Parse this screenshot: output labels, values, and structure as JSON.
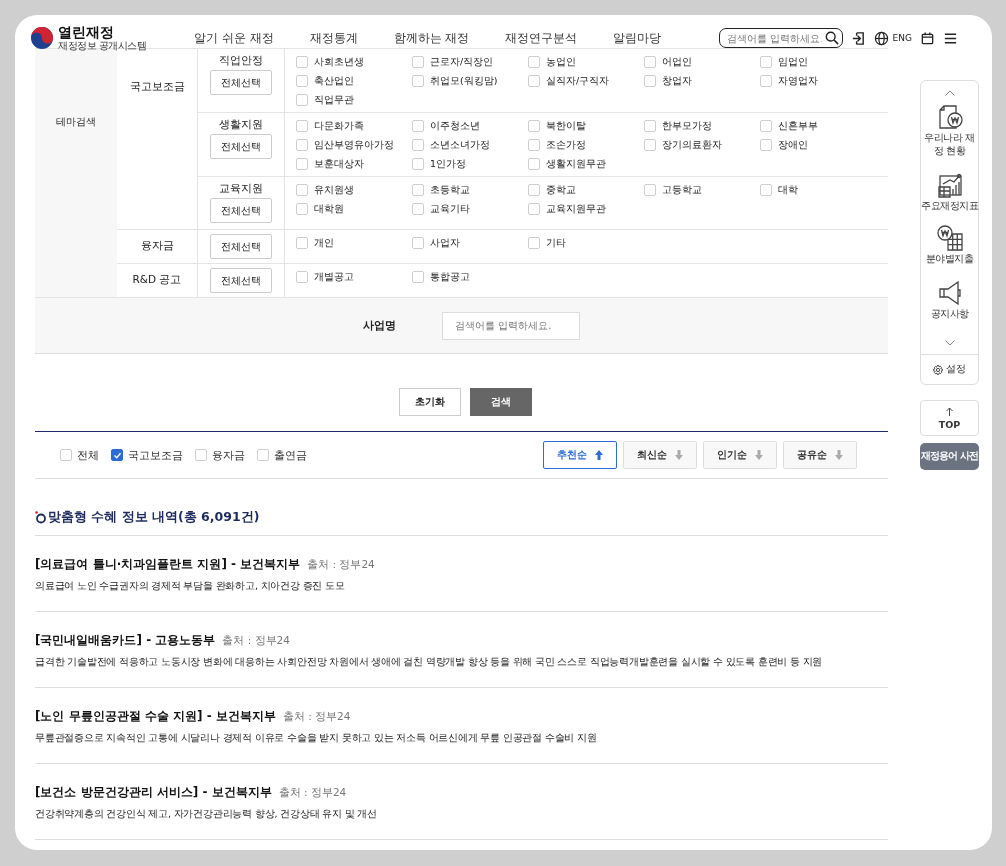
{
  "header": {
    "logo_title": "열린재정",
    "logo_subtitle": "재정정보 공개시스템",
    "nav": [
      "알기 쉬운 재정",
      "재정통계",
      "함께하는 재정",
      "재정연구분석",
      "알림마당"
    ],
    "search": {
      "placeholder": "검색어를 입력하세요."
    },
    "language": "ENG"
  },
  "filter_table": {
    "section": "테마검색",
    "groups": [
      {
        "label": "국고보조금",
        "subgroups": [
          {
            "label": "직업안정",
            "button": "전체선택",
            "options": [
              {
                "label": "사회초년생",
                "checked": false
              },
              {
                "label": "근로자/직장인",
                "checked": false
              },
              {
                "label": "농업인",
                "checked": false
              },
              {
                "label": "어업인",
                "checked": false
              },
              {
                "label": "임업인",
                "checked": false
              },
              {
                "label": "축산업인",
                "checked": false
              },
              {
                "label": "취업모(워킹맘)",
                "checked": false
              },
              {
                "label": "실직자/구직자",
                "checked": false
              },
              {
                "label": "창업자",
                "checked": false
              },
              {
                "label": "자영업자",
                "checked": false
              },
              {
                "label": "직업무관",
                "checked": false
              }
            ]
          },
          {
            "label": "생활지원",
            "button": "전체선택",
            "options": [
              {
                "label": "다문화가족",
                "checked": false
              },
              {
                "label": "이주청소년",
                "checked": false
              },
              {
                "label": "북한이탈",
                "checked": false
              },
              {
                "label": "한부모가정",
                "checked": false
              },
              {
                "label": "신혼부부",
                "checked": false
              },
              {
                "label": "임산부영유아가정",
                "checked": false
              },
              {
                "label": "소년소녀가정",
                "checked": false
              },
              {
                "label": "조손가정",
                "checked": false
              },
              {
                "label": "장기의료환자",
                "checked": false
              },
              {
                "label": "장애인",
                "checked": false
              },
              {
                "label": "보훈대상자",
                "checked": false
              },
              {
                "label": "1인가정",
                "checked": false
              },
              {
                "label": "생활지원무관",
                "checked": false
              }
            ]
          },
          {
            "label": "교육지원",
            "button": "전체선택",
            "options": [
              {
                "label": "유치원생",
                "checked": false
              },
              {
                "label": "초등학교",
                "checked": false
              },
              {
                "label": "중학교",
                "checked": false
              },
              {
                "label": "고등학교",
                "checked": false
              },
              {
                "label": "대학",
                "checked": false
              },
              {
                "label": "대학원",
                "checked": false
              },
              {
                "label": "교육기타",
                "checked": false
              },
              {
                "label": "교육지원무관",
                "checked": false
              }
            ]
          }
        ]
      },
      {
        "label": "융자금",
        "button": "전체선택",
        "options": [
          {
            "label": "개인",
            "checked": false
          },
          {
            "label": "사업자",
            "checked": false
          },
          {
            "label": "기타",
            "checked": false
          }
        ]
      },
      {
        "label": "R&D 공고",
        "button": "전체선택",
        "options": [
          {
            "label": "개별공고",
            "checked": false
          },
          {
            "label": "통합공고",
            "checked": false
          }
        ]
      }
    ],
    "name_field": {
      "label": "사업명",
      "placeholder": "검색어를 입력하세요."
    }
  },
  "actions": [
    {
      "label": "초기화",
      "kind": "reset"
    },
    {
      "label": "검색",
      "kind": "submit"
    }
  ],
  "type_filters": [
    {
      "label": "전체",
      "checked": false
    },
    {
      "label": "국고보조금",
      "checked": true
    },
    {
      "label": "융자금",
      "checked": false
    },
    {
      "label": "출연금",
      "checked": false
    }
  ],
  "sort_buttons": [
    {
      "label": "추천순",
      "selected": true
    },
    {
      "label": "최신순",
      "selected": false
    },
    {
      "label": "인기순",
      "selected": false
    },
    {
      "label": "공유순",
      "selected": false
    }
  ],
  "results": {
    "title": "맞춤형 수혜 정보 내역(총 6,091건)",
    "items": [
      {
        "title": "[의료급여 틀니·치과임플란트 지원] - 보건복지부",
        "source": "출처 : 정부24",
        "description": "의료급여 노인 수급권자의 경제적 부담을 완화하고, 치아건강 증진 도모"
      },
      {
        "title": "[국민내일배움카드] - 고용노동부",
        "source": "출처 : 정부24",
        "description": "급격한 기술발전에 적응하고 노동시장 변화에 대응하는 사회안전망 차원에서 생애에 걸친 역량개발 향상 등을 위해 국민 스스로 직업능력개발훈련을 실시할 수 있도록 훈련비 등 지원"
      },
      {
        "title": "[노인 무릎인공관절 수술 지원] - 보건복지부",
        "source": "출처 : 정부24",
        "description": "무릎관절증으로 지속적인 고통에 시달리나 경제적 이유로 수술을 받지 못하고 있는 저소득 어르신에게 무릎 인공관절 수술비 지원"
      },
      {
        "title": "[보건소 방문건강관리 서비스] - 보건복지부",
        "source": "출처 : 정부24",
        "description": "건강취약계층의 건강인식 제고, 자가건강관리능력 향상, 건강상태 유지 및 개선"
      }
    ]
  },
  "quick_menu": {
    "items": [
      {
        "label": "우리나라 재정 현황",
        "kind": "document"
      },
      {
        "label": "주요재정지표",
        "kind": "chart"
      },
      {
        "label": "분야별지출",
        "kind": "grid"
      },
      {
        "label": "공지사항",
        "kind": "megaphone"
      }
    ],
    "settings": "설정",
    "top": "TOP",
    "dictionary": "재정용어 사전"
  }
}
